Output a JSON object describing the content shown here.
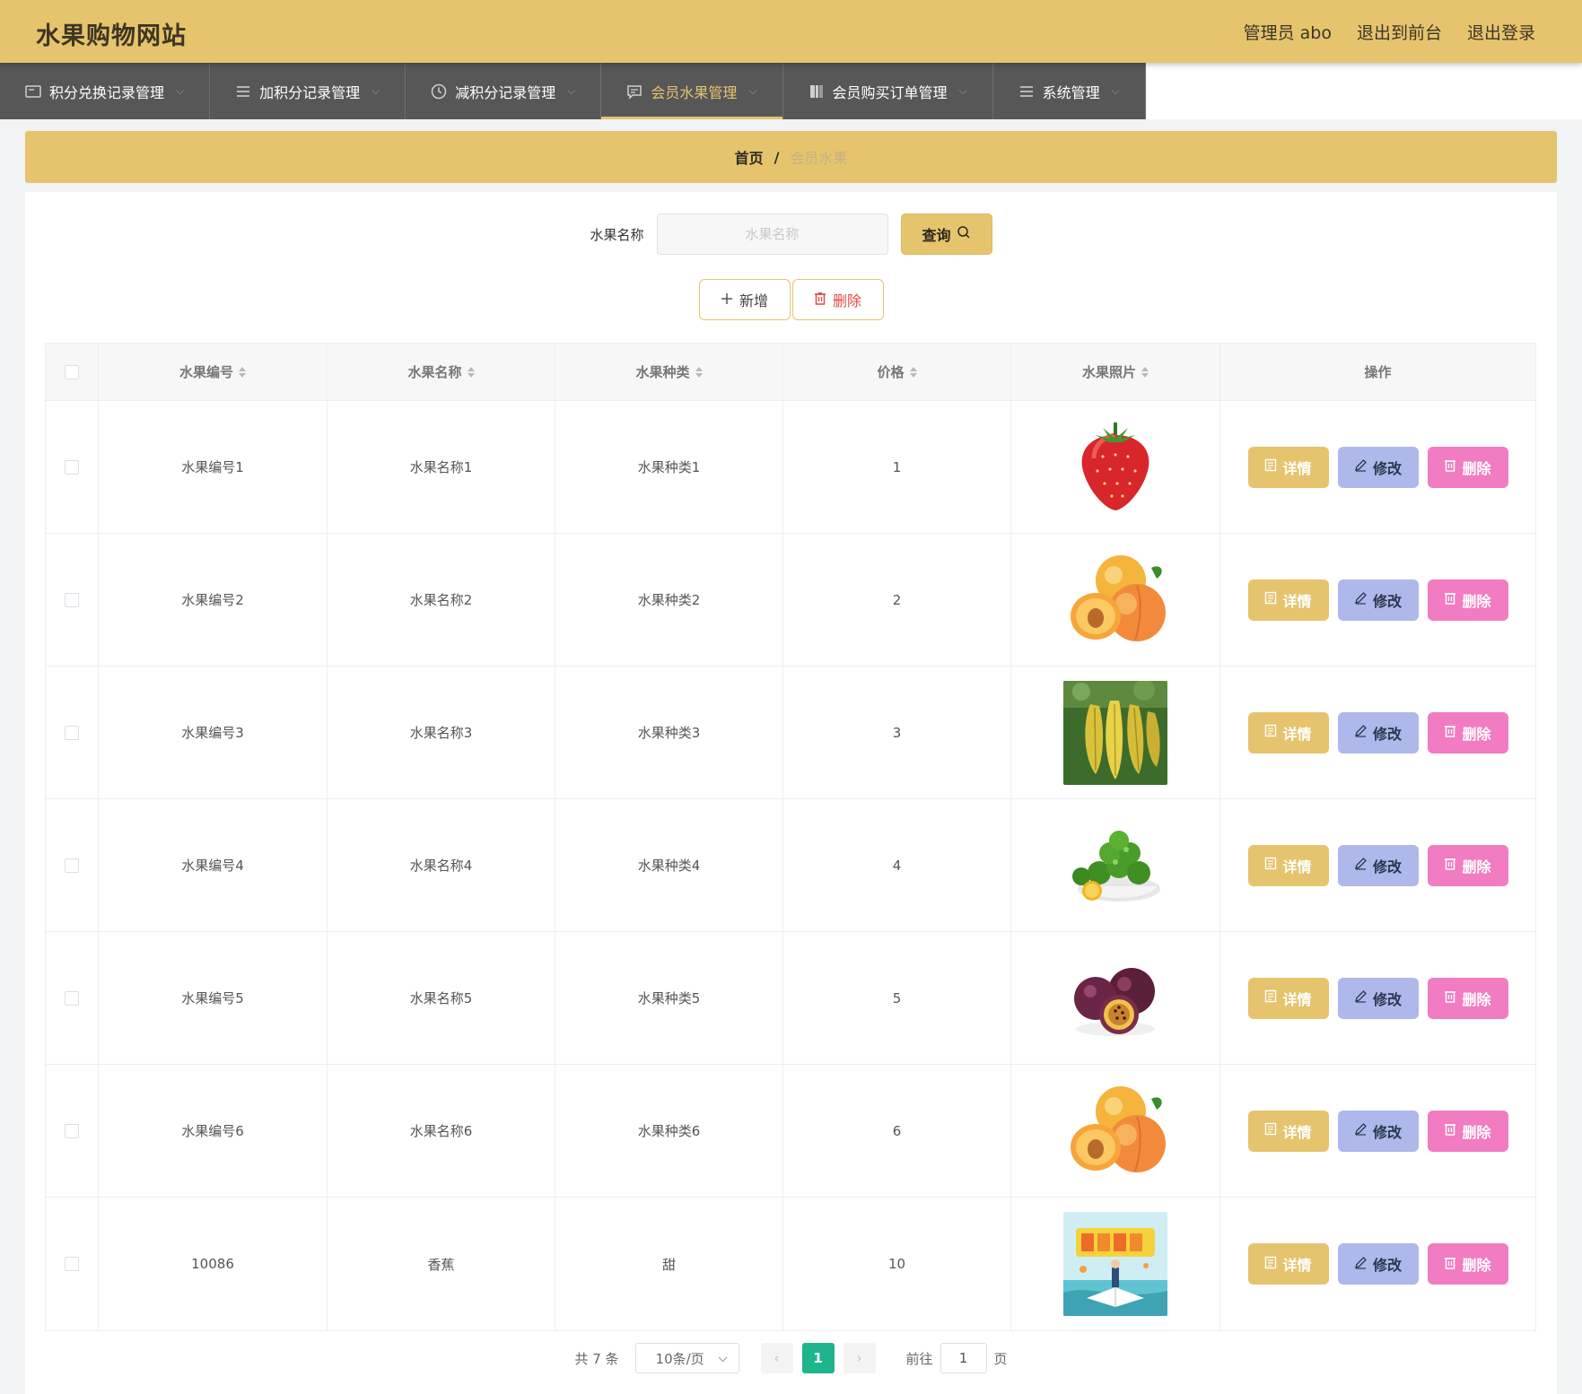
{
  "header": {
    "title": "水果购物网站",
    "links": [
      "管理员 abo",
      "退出到前台",
      "退出登录"
    ]
  },
  "nav": [
    {
      "label": "积分兑换记录管理",
      "icon": "card-icon"
    },
    {
      "label": "加积分记录管理",
      "icon": "list-icon"
    },
    {
      "label": "减积分记录管理",
      "icon": "clock-icon"
    },
    {
      "label": "会员水果管理",
      "icon": "chat-icon",
      "active": true
    },
    {
      "label": "会员购买订单管理",
      "icon": "book-icon"
    },
    {
      "label": "系统管理",
      "icon": "menu-icon"
    }
  ],
  "breadcrumb": {
    "home": "首页",
    "separator": "/",
    "current": "会员水果"
  },
  "search": {
    "label": "水果名称",
    "placeholder": "水果名称",
    "button": "查询"
  },
  "actions": {
    "add": "新增",
    "delete": "删除"
  },
  "table": {
    "columns": [
      "水果编号",
      "水果名称",
      "水果种类",
      "价格",
      "水果照片",
      "操作"
    ],
    "rows": [
      {
        "id": "水果编号1",
        "name": "水果名称1",
        "kind": "水果种类1",
        "price": "1",
        "photo": "strawberry"
      },
      {
        "id": "水果编号2",
        "name": "水果名称2",
        "kind": "水果种类2",
        "price": "2",
        "photo": "apricot"
      },
      {
        "id": "水果编号3",
        "name": "水果名称3",
        "kind": "水果种类3",
        "price": "3",
        "photo": "starfruit"
      },
      {
        "id": "水果编号4",
        "name": "水果名称4",
        "kind": "水果种类4",
        "price": "4",
        "photo": "kumquat"
      },
      {
        "id": "水果编号5",
        "name": "水果名称5",
        "kind": "水果种类5",
        "price": "5",
        "photo": "passionfruit"
      },
      {
        "id": "水果编号6",
        "name": "水果名称6",
        "kind": "水果种类6",
        "price": "6",
        "photo": "apricot"
      },
      {
        "id": "10086",
        "name": "香蕉",
        "kind": "甜",
        "price": "10",
        "photo": "poster"
      }
    ],
    "row_actions": {
      "detail": "详情",
      "edit": "修改",
      "delete": "删除"
    }
  },
  "pager": {
    "total": "共 7 条",
    "page_size": "10条/页",
    "current": "1",
    "goto_label": "前往",
    "goto_value": "1",
    "unit": "页"
  },
  "colors": {
    "accent": "#e5c46d",
    "nav_bg": "#575757",
    "edit": "#aeb8ea",
    "delete": "#f27cc1",
    "page_active": "#1fb58c"
  }
}
